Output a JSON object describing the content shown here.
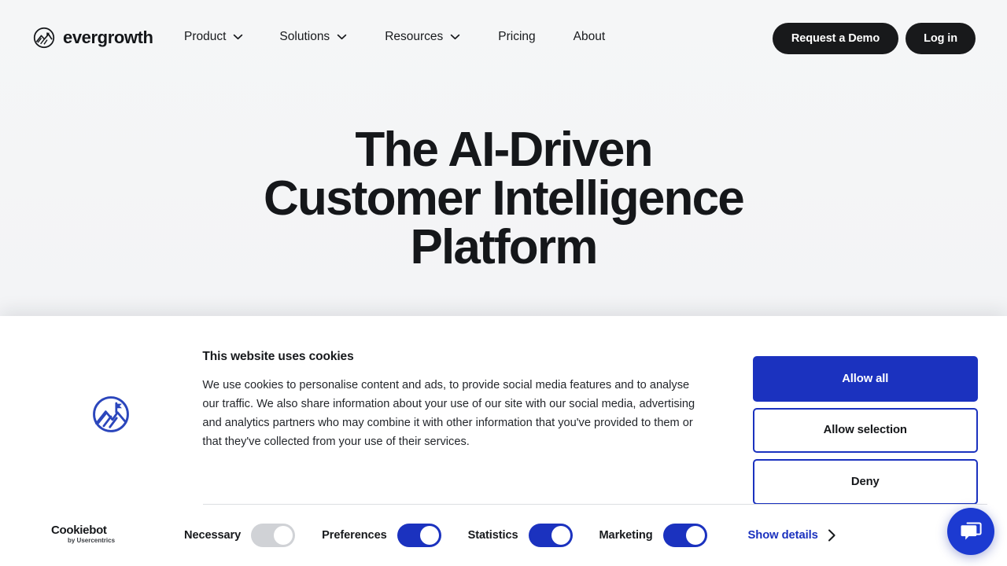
{
  "brand": {
    "name": "evergrowth",
    "logo_icon": "mountain-circle-icon"
  },
  "nav": {
    "items": [
      {
        "label": "Product",
        "has_caret": true
      },
      {
        "label": "Solutions",
        "has_caret": true
      },
      {
        "label": "Resources",
        "has_caret": true
      },
      {
        "label": "Pricing",
        "has_caret": false
      },
      {
        "label": "About",
        "has_caret": false
      }
    ],
    "actions": {
      "demo_label": "Request a Demo",
      "login_label": "Log in"
    }
  },
  "hero": {
    "line1": "The AI-Driven",
    "line2": "Customer Intelligence",
    "line3": "Platform"
  },
  "cookie_banner": {
    "icon": "mountain-circle-icon",
    "title": "This website uses cookies",
    "body": "We use cookies to personalise content and ads, to provide social media features and to analyse our traffic. We also share information about your use of our site with our social media, advertising and analytics partners who may combine it with other information that you've provided to them or that they've collected from your use of their services.",
    "buttons": {
      "allow_all": "Allow all",
      "allow_selection": "Allow selection",
      "deny": "Deny"
    },
    "vendor": {
      "name": "Cookiebot",
      "tagline": "by Usercentrics"
    },
    "consent_toggles": [
      {
        "label": "Necessary",
        "state": "off-grey",
        "checked": true,
        "disabled": true
      },
      {
        "label": "Preferences",
        "state": "on-blue",
        "checked": true,
        "disabled": false
      },
      {
        "label": "Statistics",
        "state": "on-blue",
        "checked": true,
        "disabled": false
      },
      {
        "label": "Marketing",
        "state": "on-blue",
        "checked": true,
        "disabled": false
      }
    ],
    "show_details_label": "Show details",
    "show_details_icon": "chevron-right-icon"
  },
  "chat": {
    "icon": "chat-bubbles-icon"
  },
  "colors": {
    "page_bg": "#f4f5f7",
    "text_dark": "#15171a",
    "button_dark": "#18191b",
    "accent_blue": "#1b32bf",
    "chat_blue": "#1c3ad1",
    "toggle_grey": "#d0d2d6",
    "divider": "#dcdee1"
  }
}
